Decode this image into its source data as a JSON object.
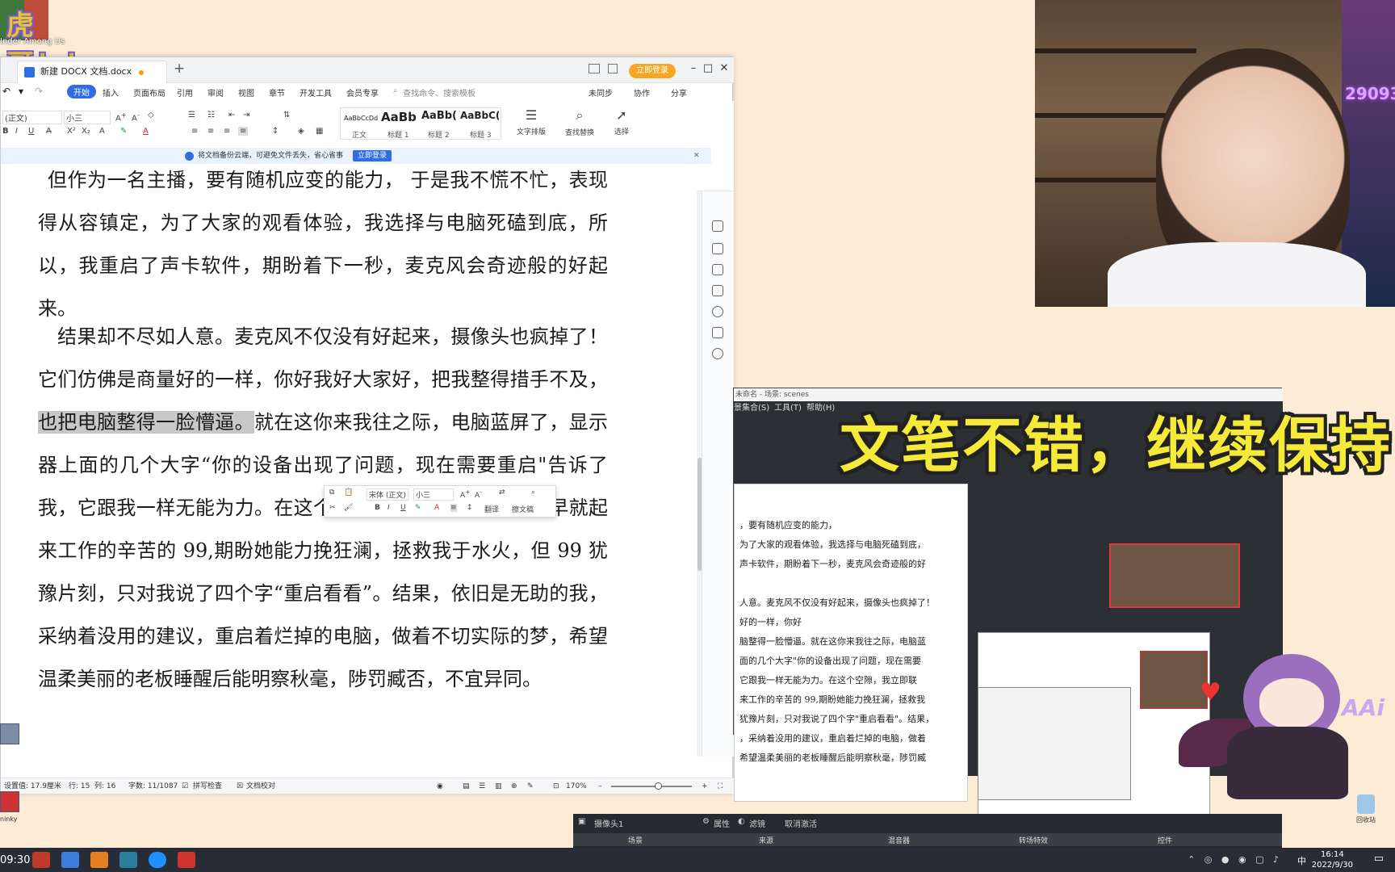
{
  "overlay": {
    "badge": "虎哥！！",
    "slogan": "文笔不错，继续保持",
    "chibi_text": "AAi",
    "desktop_label": "Inder Among Us"
  },
  "doc_window": {
    "tab_title": "新建 DOCX 文档.docx",
    "login_button": "立即登录",
    "menus": [
      "开始",
      "插入",
      "页面布局",
      "引用",
      "审阅",
      "视图",
      "章节",
      "开发工具",
      "会员专享"
    ],
    "search_placeholder": "查找命令、搜索模板",
    "right_actions": [
      "未同步",
      "协作",
      "分享"
    ],
    "font_name": "(正文)",
    "font_size": "小三",
    "styles": [
      {
        "preview": "AaBbCcDd",
        "label": "正文"
      },
      {
        "preview": "AaBb",
        "label": "标题 1"
      },
      {
        "preview": "AaBb(",
        "label": "标题 2"
      },
      {
        "preview": "AaBbC(",
        "label": "标题 3"
      }
    ],
    "big_tools": [
      "文字排版",
      "查找替换",
      "选择"
    ],
    "notice_text": "将文档备份云端，可避免文件丢失，省心省事",
    "notice_button": "立即登录",
    "paragraphs": [
      {
        "indent": true,
        "text": "但作为一名主播，要有随机应变的能力， 于是我不慌不忙，表现得从容镇定，为了大家的观看体验，我选择与电脑死磕到底，所以，我重启了声卡软件，期盼着下一秒，麦克风会奇迹般的好起来。"
      },
      {
        "indent": true,
        "text_before": "结果却不尽如人意。麦克风不仅没有好起来，摄像头也疯掉了！它们仿佛是商量好的一样，你好我好大家好，把我整得措手不及，",
        "highlight": "也把电脑整得一脸懵逼。",
        "text_after": "就在这你来我往之际，电脑蓝屏了，显示器上面的几个大字“你的设备出现了问题，现在需要重启\"告诉了我，它跟我一样无能为力。在这个空隙，我立即联系了一大早就起来工作的辛苦的 99,期盼她能力挽狂澜，拯救我于水火，但 99 犹豫片刻，只对我说了四个字“重启看看”。结果，依旧是无助的我，采纳着没用的建议，重启着烂掉的电脑，做着不切实际的梦，希望温柔美丽的老板睡醒后能明察秋毫，陟罚臧否，不宜异同。"
      }
    ],
    "mini_toolbar": {
      "font": "宋体 (正文)",
      "size": "小三",
      "items": [
        "翻译",
        "擦文稿"
      ]
    },
    "status": {
      "setting": "设置值: 17.9厘米",
      "row": "行: 15",
      "col": "列: 16",
      "words": "字数: 11/1087",
      "spell": "拼写检查",
      "proof": "文档校对",
      "zoom": "170%"
    }
  },
  "obs": {
    "title": "未命名 - 场景: scenes",
    "menus": [
      "景集合(S)",
      "工具(T)",
      "帮助(H)"
    ],
    "source_label": "摄像头1",
    "buttons": [
      "属性",
      "滤镜",
      "取消激活"
    ],
    "docks": [
      "场景",
      "来源",
      "混音器",
      "转场特效",
      "控件"
    ],
    "inner_lines": [
      "，要有随机应变的能力，",
      "为了大家的观看体验，我选择与电脑死磕到底，",
      "声卡软件，期盼着下一秒，麦克风会奇迹般的好",
      "",
      "人意。麦克风不仅没有好起来，摄像头也疯掉了！",
      "好的一样，你好",
      "脑整得一脸懵逼。就在这你来我往之际，电脑蓝",
      "面的几个大字\"你的设备出现了问题，现在需要",
      "它跟我一样无能为力。在这个空隙，我立即联",
      "来工作的辛苦的 99,期盼她能力挽狂澜，拯救我",
      "犹豫片刻，只对我说了四个字\"重启看看\"。结果，",
      "，采纳着没用的建议，重启着烂掉的电脑，做着",
      "希望温柔美丽的老板睡醒后能明察秋毫，陟罚臧"
    ]
  },
  "webcam": {
    "number": "29093"
  },
  "desktop": {
    "recycle_label": "回收站",
    "left_icon_label": "ninky"
  },
  "taskbar": {
    "left_clock": "09:30",
    "time": "16:14",
    "date": "2022/9/30",
    "ime": "中"
  }
}
